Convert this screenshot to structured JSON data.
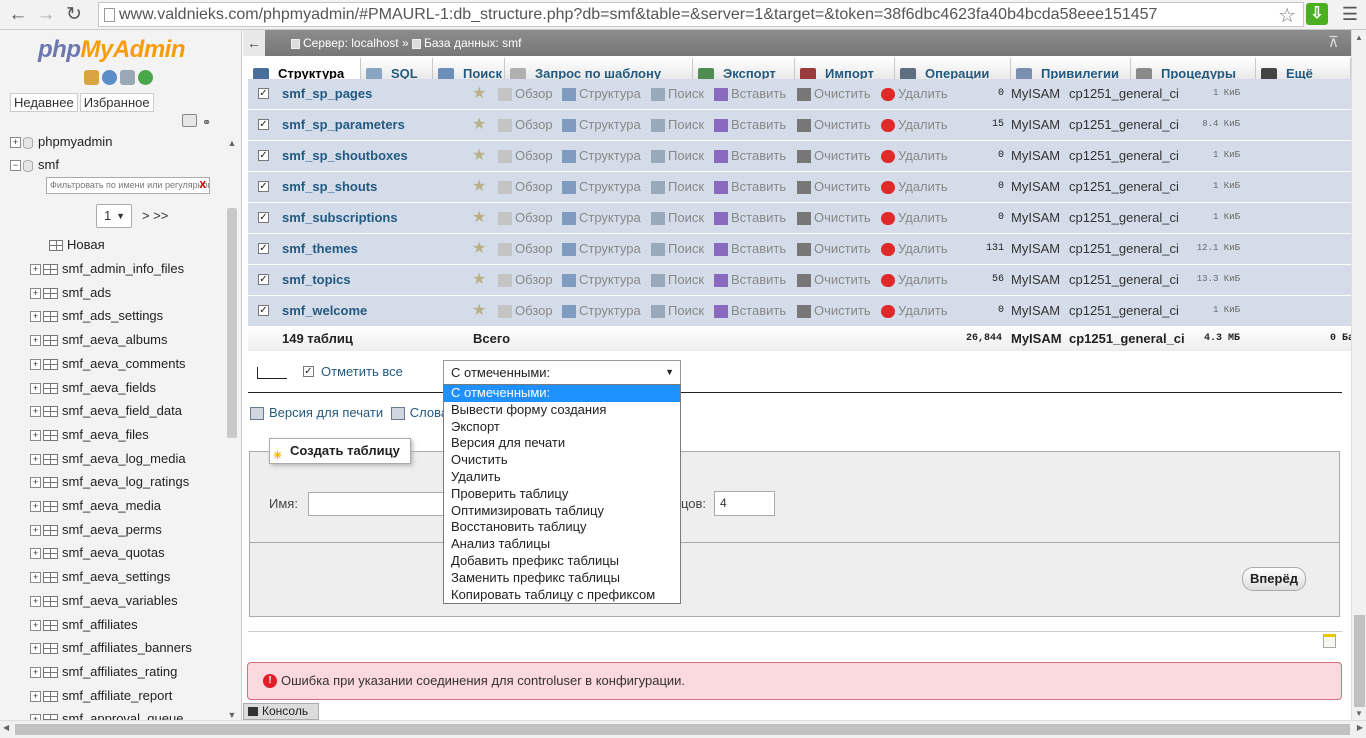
{
  "browser": {
    "url": "www.valdnieks.com/phpmyadmin/#PMAURL-1:db_structure.php?db=smf&table=&server=1&target=&token=38f6dbc4623fa40b4bcda58eee151457"
  },
  "sidebar": {
    "logo_php": "php",
    "logo_myadmin": "MyAdmin",
    "tab_recent": "Недавнее",
    "tab_favorites": "Избранное",
    "db_phpmyadmin": "phpmyadmin",
    "db_smf": "smf",
    "filter_placeholder": "Фильтровать по имени или регулярному выражению",
    "filter_clear": "X",
    "page_value": "1",
    "page_next": "> >>",
    "new_item": "Новая",
    "tables": [
      "smf_admin_info_files",
      "smf_ads",
      "smf_ads_settings",
      "smf_aeva_albums",
      "smf_aeva_comments",
      "smf_aeva_fields",
      "smf_aeva_field_data",
      "smf_aeva_files",
      "smf_aeva_log_media",
      "smf_aeva_log_ratings",
      "smf_aeva_media",
      "smf_aeva_perms",
      "smf_aeva_quotas",
      "smf_aeva_settings",
      "smf_aeva_variables",
      "smf_affiliates",
      "smf_affiliates_banners",
      "smf_affiliates_rating",
      "smf_affiliate_report",
      "smf_approval_queue"
    ]
  },
  "breadcrumb": {
    "server": "Сервер: localhost",
    "sep": "»",
    "database": "База данных: smf"
  },
  "tabs": [
    "Структура",
    "SQL",
    "Поиск",
    "Запрос по шаблону",
    "Экспорт",
    "Импорт",
    "Операции",
    "Привилегии",
    "Процедуры",
    "Ещё"
  ],
  "actions": {
    "browse": "Обзор",
    "structure": "Структура",
    "search": "Поиск",
    "insert": "Вставить",
    "empty": "Очистить",
    "drop": "Удалить"
  },
  "table_rows": [
    {
      "name": "smf_sp_pages",
      "rows": "0",
      "engine": "MyISAM",
      "collation": "cp1251_general_ci",
      "size": "1 КиБ"
    },
    {
      "name": "smf_sp_parameters",
      "rows": "15",
      "engine": "MyISAM",
      "collation": "cp1251_general_ci",
      "size": "8.4 КиБ"
    },
    {
      "name": "smf_sp_shoutboxes",
      "rows": "0",
      "engine": "MyISAM",
      "collation": "cp1251_general_ci",
      "size": "1 КиБ"
    },
    {
      "name": "smf_sp_shouts",
      "rows": "0",
      "engine": "MyISAM",
      "collation": "cp1251_general_ci",
      "size": "1 КиБ"
    },
    {
      "name": "smf_subscriptions",
      "rows": "0",
      "engine": "MyISAM",
      "collation": "cp1251_general_ci",
      "size": "1 КиБ"
    },
    {
      "name": "smf_themes",
      "rows": "131",
      "engine": "MyISAM",
      "collation": "cp1251_general_ci",
      "size": "12.1 КиБ"
    },
    {
      "name": "smf_topics",
      "rows": "56",
      "engine": "MyISAM",
      "collation": "cp1251_general_ci",
      "size": "13.3 КиБ"
    },
    {
      "name": "smf_welcome",
      "rows": "0",
      "engine": "MyISAM",
      "collation": "cp1251_general_ci",
      "size": "1 КиБ"
    }
  ],
  "summary": {
    "tables": "149 таблиц",
    "total": "Всего",
    "rows": "26,844",
    "engine": "MyISAM",
    "collation": "cp1251_general_ci",
    "size": "4.3 МБ",
    "overhead": "0 Ба"
  },
  "check_all": "Отметить все",
  "with_selected": "С отмеченными:",
  "dropdown_options": [
    "С отмеченными:",
    "Вывести форму создания",
    "Экспорт",
    "Версия для печати",
    "Очистить",
    "Удалить",
    "Проверить таблицу",
    "Оптимизировать таблицу",
    "Восстановить таблицу",
    "Анализ таблицы",
    "Добавить префикс таблицы",
    "Заменить префикс таблицы",
    "Копировать таблицу с префиксом"
  ],
  "print_view": "Версия для печати",
  "data_dict": "Слова",
  "create_table": {
    "legend": "Создать таблицу",
    "name_label": "Имя:",
    "cols_label": "цов:",
    "cols_value": "4",
    "go": "Вперёд"
  },
  "error": "Ошибка при указании соединения для controluser в конфигурации.",
  "console": "Консоль"
}
